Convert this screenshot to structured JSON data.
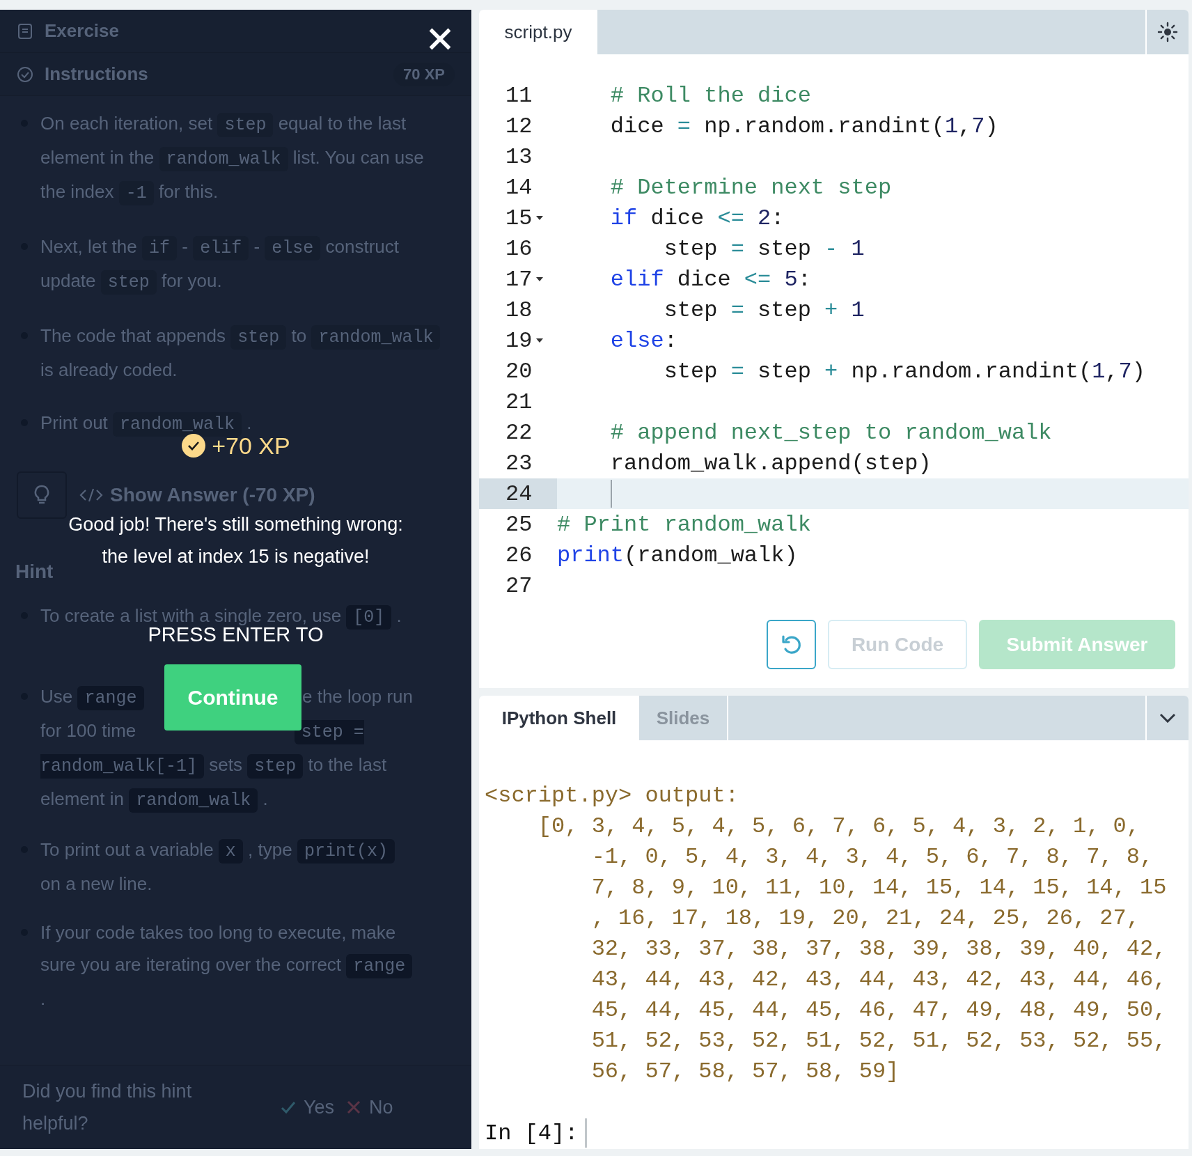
{
  "exercise_panel": {
    "header": {
      "title": "Exercise"
    },
    "instructions": {
      "title": "Instructions",
      "xp": "70 XP",
      "items": [
        [
          {
            "kind": "text",
            "text": "On each iteration, set"
          },
          {
            "kind": "code",
            "text": "step"
          },
          {
            "kind": "text",
            "text": "equal to the last element in the"
          },
          {
            "kind": "code",
            "text": "random_walk"
          },
          {
            "kind": "text",
            "text": "list. You can use the index"
          },
          {
            "kind": "code",
            "text": "-1"
          },
          {
            "kind": "text",
            "text": "for this."
          }
        ],
        [
          {
            "kind": "text",
            "text": "Next, let the"
          },
          {
            "kind": "code",
            "text": "if"
          },
          {
            "kind": "text",
            "text": "-"
          },
          {
            "kind": "code",
            "text": "elif"
          },
          {
            "kind": "text",
            "text": "-"
          },
          {
            "kind": "code",
            "text": "else"
          },
          {
            "kind": "text",
            "text": "construct update"
          },
          {
            "kind": "code",
            "text": "step"
          },
          {
            "kind": "text",
            "text": "for you."
          }
        ],
        [
          {
            "kind": "text",
            "text": "The code that appends"
          },
          {
            "kind": "code",
            "text": "step"
          },
          {
            "kind": "text",
            "text": "to"
          },
          {
            "kind": "code",
            "text": "random_walk"
          },
          {
            "kind": "text",
            "text": "is already coded."
          }
        ],
        [
          {
            "kind": "text",
            "text": "Print out"
          },
          {
            "kind": "code",
            "text": "random_walk"
          },
          {
            "kind": "text",
            "text": "."
          }
        ]
      ]
    },
    "show_answer": {
      "label": "Show Answer (-70 XP)"
    },
    "hint": {
      "title": "Hint",
      "items": [
        [
          {
            "kind": "text",
            "text": "To create a list with a single zero, use"
          },
          {
            "kind": "code",
            "text": "[0]"
          },
          {
            "kind": "text",
            "text": "."
          }
        ],
        [
          {
            "kind": "text",
            "text": "Use"
          },
          {
            "kind": "code",
            "text": "range"
          },
          {
            "kind": "covered"
          },
          {
            "kind": "text",
            "text": "e the loop run"
          },
          {
            "kind": "text",
            "text": "for 100 time"
          },
          {
            "kind": "covered"
          },
          {
            "kind": "code",
            "text": "step = random_walk[-1]"
          },
          {
            "kind": "text",
            "text": "sets"
          },
          {
            "kind": "code",
            "text": "step"
          },
          {
            "kind": "text",
            "text": "to the last element in"
          },
          {
            "kind": "code",
            "text": "random_walk"
          },
          {
            "kind": "text",
            "text": "."
          }
        ],
        [
          {
            "kind": "text",
            "text": "To print out a variable"
          },
          {
            "kind": "code",
            "text": "x"
          },
          {
            "kind": "text",
            "text": ", type"
          },
          {
            "kind": "code",
            "text": "print(x)"
          },
          {
            "kind": "text",
            "text": "on a new line."
          }
        ],
        [
          {
            "kind": "text",
            "text": "If your code takes too long to execute, make sure you are iterating over the correct"
          },
          {
            "kind": "code",
            "text": "range"
          },
          {
            "kind": "text",
            "text": "."
          }
        ]
      ]
    },
    "feedback": {
      "question": "Did you find this hint helpful?",
      "options": [
        {
          "kind": "yes",
          "label": "Yes"
        },
        {
          "kind": "no",
          "label": "No"
        }
      ]
    }
  },
  "completion_overlay": {
    "xp": "+70 XP",
    "message": "Good job! There's still something wrong: the level at index 15 is negative!",
    "prompt": "PRESS ENTER TO",
    "button": "Continue"
  },
  "editor": {
    "tab": {
      "label": "script.py",
      "selected": true
    },
    "lines": [
      {
        "n": "11",
        "tokens": [
          {
            "kind": "comment",
            "text": "    # Roll the dice"
          }
        ]
      },
      {
        "n": "12",
        "tokens": [
          {
            "kind": "plain",
            "text": "    dice "
          },
          {
            "kind": "operator",
            "text": "="
          },
          {
            "kind": "plain",
            "text": " np.random.randint("
          },
          {
            "kind": "number",
            "text": "1"
          },
          {
            "kind": "plain",
            "text": ","
          },
          {
            "kind": "number",
            "text": "7"
          },
          {
            "kind": "plain",
            "text": ")"
          }
        ]
      },
      {
        "n": "13"
      },
      {
        "n": "14",
        "tokens": [
          {
            "kind": "comment",
            "text": "    # Determine next step"
          }
        ]
      },
      {
        "n": "15",
        "fold": true,
        "tokens": [
          {
            "kind": "keyword",
            "text": "    if"
          },
          {
            "kind": "plain",
            "text": " dice "
          },
          {
            "kind": "operator",
            "text": "<="
          },
          {
            "kind": "number",
            "text": " 2"
          },
          {
            "kind": "plain",
            "text": ":"
          }
        ]
      },
      {
        "n": "16",
        "tokens": [
          {
            "kind": "plain",
            "text": "        step "
          },
          {
            "kind": "operator",
            "text": "="
          },
          {
            "kind": "plain",
            "text": " step "
          },
          {
            "kind": "operator",
            "text": "-"
          },
          {
            "kind": "number",
            "text": " 1"
          }
        ]
      },
      {
        "n": "17",
        "fold": true,
        "tokens": [
          {
            "kind": "keyword",
            "text": "    elif"
          },
          {
            "kind": "plain",
            "text": " dice "
          },
          {
            "kind": "operator",
            "text": "<="
          },
          {
            "kind": "number",
            "text": " 5"
          },
          {
            "kind": "plain",
            "text": ":"
          }
        ]
      },
      {
        "n": "18",
        "tokens": [
          {
            "kind": "plain",
            "text": "        step "
          },
          {
            "kind": "operator",
            "text": "="
          },
          {
            "kind": "plain",
            "text": " step "
          },
          {
            "kind": "operator",
            "text": "+"
          },
          {
            "kind": "number",
            "text": " 1"
          }
        ]
      },
      {
        "n": "19",
        "fold": true,
        "tokens": [
          {
            "kind": "keyword",
            "text": "    else"
          },
          {
            "kind": "plain",
            "text": ":"
          }
        ]
      },
      {
        "n": "20",
        "tokens": [
          {
            "kind": "plain",
            "text": "        step "
          },
          {
            "kind": "operator",
            "text": "="
          },
          {
            "kind": "plain",
            "text": " step "
          },
          {
            "kind": "operator",
            "text": "+"
          },
          {
            "kind": "plain",
            "text": " np.random.randint("
          },
          {
            "kind": "number",
            "text": "1"
          },
          {
            "kind": "plain",
            "text": ","
          },
          {
            "kind": "number",
            "text": "7"
          },
          {
            "kind": "plain",
            "text": ")"
          }
        ]
      },
      {
        "n": "21"
      },
      {
        "n": "22",
        "tokens": [
          {
            "kind": "comment",
            "text": "    # append next_step to random_walk"
          }
        ]
      },
      {
        "n": "23",
        "tokens": [
          {
            "kind": "plain",
            "text": "    random_walk.append(step)"
          }
        ]
      },
      {
        "n": "24",
        "active": true
      },
      {
        "n": "25",
        "tokens": [
          {
            "kind": "comment",
            "text": "# Print random_walk"
          }
        ]
      },
      {
        "n": "26",
        "tokens": [
          {
            "kind": "keyword",
            "text": "print"
          },
          {
            "kind": "plain",
            "text": "(random_walk)"
          }
        ]
      },
      {
        "n": "27"
      }
    ],
    "buttons": [
      {
        "kind": "reset",
        "disabled": false
      },
      {
        "kind": "run",
        "label": "Run Code",
        "disabled": true
      },
      {
        "kind": "submit",
        "label": "Submit Answer",
        "disabled": true
      }
    ]
  },
  "shell": {
    "tabs": [
      {
        "label": "IPython Shell",
        "selected": true
      },
      {
        "label": "Slides",
        "selected": false
      }
    ],
    "output": [
      "<script.py> output:",
      "    [0, 3, 4, 5, 4, 5, 6, 7, 6, 5, 4, 3, 2, 1, 0,",
      "        -1, 0, 5, 4, 3, 4, 3, 4, 5, 6, 7, 8, 7, 8,",
      "        7, 8, 9, 10, 11, 10, 14, 15, 14, 15, 14, 15",
      "        , 16, 17, 18, 19, 20, 21, 24, 25, 26, 27,",
      "        32, 33, 37, 38, 37, 38, 39, 38, 39, 40, 42,",
      "        43, 44, 43, 42, 43, 44, 43, 42, 43, 44, 46,",
      "        45, 44, 45, 44, 45, 46, 47, 49, 48, 49, 50,",
      "        51, 52, 53, 52, 51, 52, 51, 52, 53, 52, 55,",
      "        56, 57, 58, 57, 58, 59]"
    ],
    "prompt": "In [4]:"
  }
}
